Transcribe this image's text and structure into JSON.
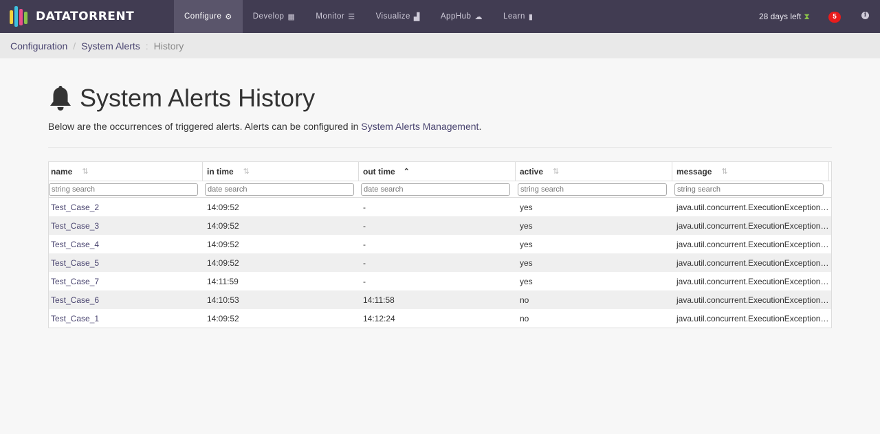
{
  "brand": {
    "name": "DATATORRENT"
  },
  "nav": {
    "items": [
      {
        "label": "Configure",
        "icon": "gear-icon"
      },
      {
        "label": "Develop",
        "icon": "grid-icon"
      },
      {
        "label": "Monitor",
        "icon": "server-icon"
      },
      {
        "label": "Visualize",
        "icon": "bar-chart-icon"
      },
      {
        "label": "AppHub",
        "icon": "cloud-icon"
      },
      {
        "label": "Learn",
        "icon": "book-icon"
      }
    ],
    "active": "Configure"
  },
  "header_right": {
    "trial": "28 days left",
    "notifications": "5"
  },
  "breadcrumb": [
    "Configuration",
    "System Alerts",
    "History"
  ],
  "page": {
    "title": "System Alerts History",
    "desc_prefix": "Below are the occurrences of triggered alerts. Alerts can be configured in ",
    "desc_link": "System Alerts Management",
    "desc_suffix": "."
  },
  "table": {
    "columns": [
      "name",
      "in time",
      "out time",
      "active",
      "message"
    ],
    "sorted_column": "out time",
    "filters": [
      "string search",
      "date search",
      "date search",
      "string search",
      "string search"
    ],
    "rows": [
      {
        "name": "Test_Case_2",
        "in_time": "14:09:52",
        "out_time": "-",
        "active": "yes",
        "message": "java.util.concurrent.ExecutionException…"
      },
      {
        "name": "Test_Case_3",
        "in_time": "14:09:52",
        "out_time": "-",
        "active": "yes",
        "message": "java.util.concurrent.ExecutionException…"
      },
      {
        "name": "Test_Case_4",
        "in_time": "14:09:52",
        "out_time": "-",
        "active": "yes",
        "message": "java.util.concurrent.ExecutionException…"
      },
      {
        "name": "Test_Case_5",
        "in_time": "14:09:52",
        "out_time": "-",
        "active": "yes",
        "message": "java.util.concurrent.ExecutionException…"
      },
      {
        "name": "Test_Case_7",
        "in_time": "14:11:59",
        "out_time": "-",
        "active": "yes",
        "message": "java.util.concurrent.ExecutionException…"
      },
      {
        "name": "Test_Case_6",
        "in_time": "14:10:53",
        "out_time": "14:11:58",
        "active": "no",
        "message": "java.util.concurrent.ExecutionException…"
      },
      {
        "name": "Test_Case_1",
        "in_time": "14:09:52",
        "out_time": "14:12:24",
        "active": "no",
        "message": "java.util.concurrent.ExecutionException…"
      }
    ]
  },
  "colors": {
    "topbar": "#413c52",
    "link": "#4a4570",
    "badge": "#e91c1c"
  }
}
